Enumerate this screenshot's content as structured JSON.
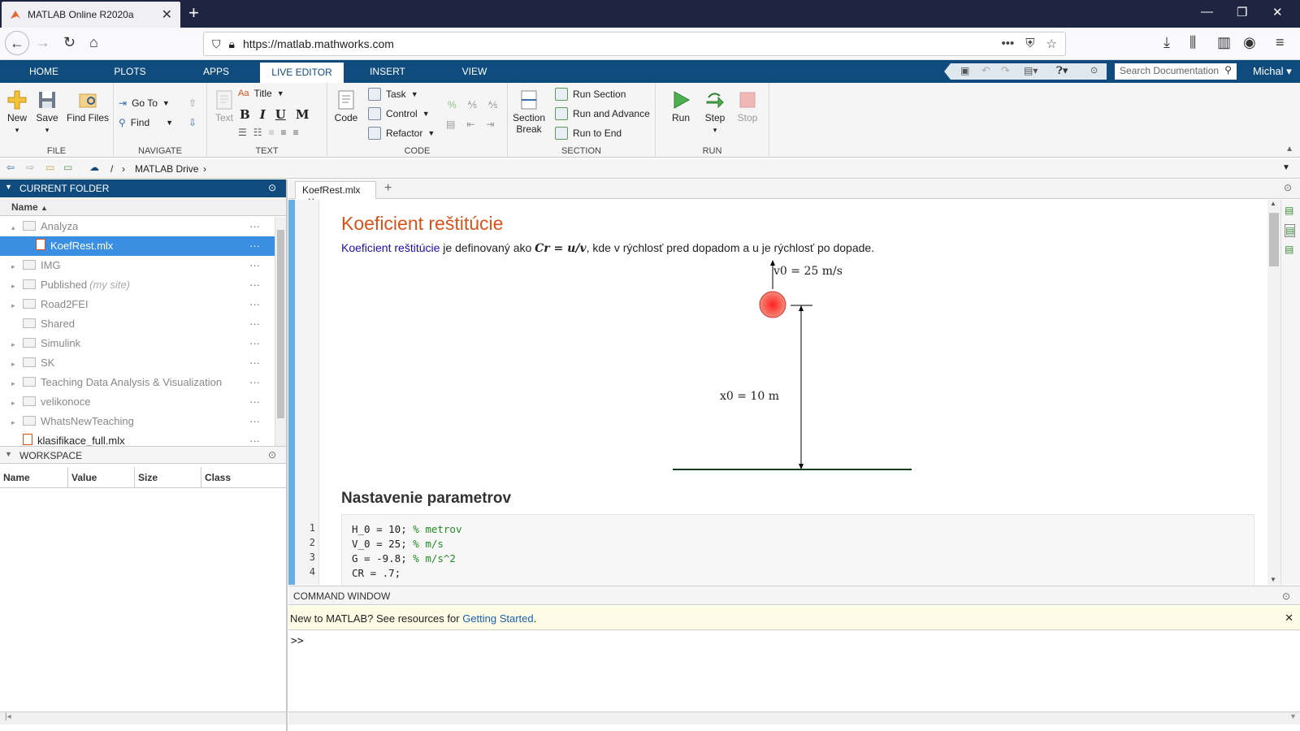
{
  "browser": {
    "tab_title": "MATLAB Online R2020a",
    "url": "https://matlab.mathworks.com"
  },
  "matlab_tabs": [
    "HOME",
    "PLOTS",
    "APPS",
    "LIVE EDITOR",
    "INSERT",
    "VIEW"
  ],
  "search_placeholder": "Search Documentation",
  "user": "Michal",
  "ribbon": {
    "file": {
      "new": "New",
      "save": "Save",
      "find_files": "Find Files",
      "label": "FILE"
    },
    "navigate": {
      "go_to": "Go To",
      "find": "Find",
      "label": "NAVIGATE"
    },
    "text": {
      "title": "Title",
      "text": "Text",
      "bold": "B",
      "italic": "I",
      "underline": "U",
      "monospace": "M",
      "label": "TEXT"
    },
    "code": {
      "code": "Code",
      "task": "Task",
      "control": "Control",
      "refactor": "Refactor",
      "label": "CODE"
    },
    "section": {
      "section_break_1": "Section",
      "section_break_2": "Break",
      "run_section": "Run Section",
      "run_advance": "Run and Advance",
      "run_end": "Run to End",
      "label": "SECTION"
    },
    "run": {
      "run": "Run",
      "step": "Step",
      "stop": "Stop",
      "label": "RUN"
    }
  },
  "address": {
    "sep": "/",
    "path": "MATLAB Drive"
  },
  "current_folder": {
    "title": "CURRENT FOLDER",
    "col_name": "Name",
    "items": [
      {
        "name": "Analyza",
        "note": ""
      },
      {
        "name": "KoefRest.mlx",
        "note": ""
      },
      {
        "name": "IMG",
        "note": ""
      },
      {
        "name": "Published",
        "note": "(my site)"
      },
      {
        "name": "Road2FEI",
        "note": ""
      },
      {
        "name": "Shared",
        "note": ""
      },
      {
        "name": "Simulink",
        "note": ""
      },
      {
        "name": "SK",
        "note": ""
      },
      {
        "name": "Teaching Data Analysis & Visualization",
        "note": ""
      },
      {
        "name": "velikonoce",
        "note": ""
      },
      {
        "name": "WhatsNewTeaching",
        "note": ""
      },
      {
        "name": "klasifikace_full.mlx",
        "note": ""
      }
    ],
    "dots": "···"
  },
  "workspace": {
    "title": "WORKSPACE",
    "cols": [
      "Name",
      "Value",
      "Size",
      "Class"
    ]
  },
  "editor": {
    "tab": "KoefRest.mlx",
    "title": "Koeficient reštitúcie",
    "para_link": "Koeficient reštitúcie",
    "para_1": " je definovaný ako ",
    "para_math": "Cr = u/v",
    "para_2": ", kde v rýchlosť pred dopadom a u je rýchlosť po dopade.",
    "fig_v0": "v0 = 25 m/s",
    "fig_x0": "x0 = 10 m",
    "heading": "Nastavenie parametrov",
    "code_lines": [
      {
        "n": "1",
        "code": "H_0 = 10; ",
        "comment": "% metrov"
      },
      {
        "n": "2",
        "code": "V_0 = 25; ",
        "comment": "% m/s"
      },
      {
        "n": "3",
        "code": "G = -9.8; ",
        "comment": "% m/s^2"
      },
      {
        "n": "4",
        "code": "CR = .7;",
        "comment": ""
      }
    ]
  },
  "command_window": {
    "title": "COMMAND WINDOW",
    "tip_1": "New to MATLAB? See resources for ",
    "tip_link": "Getting Started",
    "tip_2": ".",
    "prompt": ">>"
  },
  "colors": {
    "matlab_blue": "#0f4c7d",
    "title_orange": "#d95319",
    "selection": "#3b8fe2"
  }
}
